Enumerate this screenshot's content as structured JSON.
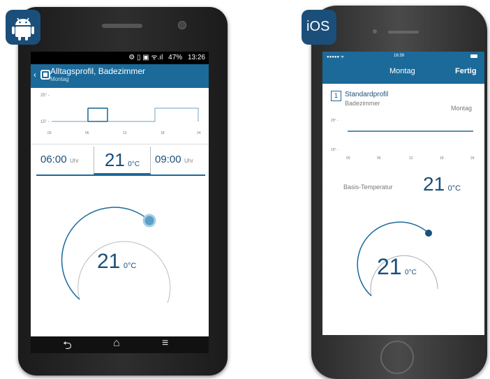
{
  "android": {
    "badge_icon": "android-robot-icon",
    "status_bar": {
      "battery": "47%",
      "time": "13:26"
    },
    "header": {
      "title": "Alltagsprofil, Badezimmer",
      "subtitle": "Montag"
    },
    "chart": {
      "y_top": "25° -",
      "y_bottom": "15° -",
      "x_ticks": [
        "00",
        "06",
        "12",
        "18",
        "24"
      ]
    },
    "schedule": {
      "start": "06:00",
      "start_unit": "Uhr",
      "temp": "21",
      "temp_unit": "0°C",
      "end": "09:00",
      "end_unit": "Uhr"
    },
    "dial": {
      "value": "21",
      "unit": "0°C",
      "level": 0.75
    },
    "nav_icons": [
      "back-arrow-icon",
      "home-icon",
      "menu-icon"
    ]
  },
  "ios": {
    "badge_label": "iOS",
    "status_bar": {
      "signal": "●●●●● ᯤ",
      "time": "16:39"
    },
    "header": {
      "title": "Montag",
      "done": "Fertig"
    },
    "profile": {
      "number": "1",
      "name": "Standardprofil",
      "room": "Badezimmer",
      "day": "Montag"
    },
    "chart": {
      "y_top": "25° -",
      "y_bottom": "15° -",
      "x_ticks": [
        "00",
        "06",
        "12",
        "18",
        "24"
      ]
    },
    "base_temp": {
      "label": "Basis-Temperatur",
      "value": "21",
      "unit": "0°C"
    },
    "dial": {
      "value": "21",
      "unit": "0°C",
      "level": 0.75
    }
  },
  "colors": {
    "accent": "#1b6a9a",
    "badge": "#1b4f7a"
  }
}
